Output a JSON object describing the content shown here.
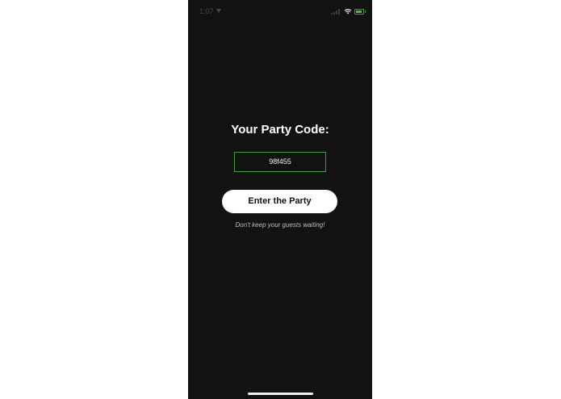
{
  "status_bar": {
    "time": "1:07",
    "icons": [
      "location-icon",
      "signal-icon",
      "wifi-icon",
      "battery-icon"
    ],
    "battery_color": "#46c046"
  },
  "main": {
    "heading": "Your Party Code:",
    "party_code": "98f455",
    "enter_button_label": "Enter the Party",
    "tagline": "Don't keep your guests waiting!"
  },
  "colors": {
    "background": "#121212",
    "code_border": "#3e9b3e",
    "button_background": "#ffffff",
    "button_text": "#111111"
  }
}
